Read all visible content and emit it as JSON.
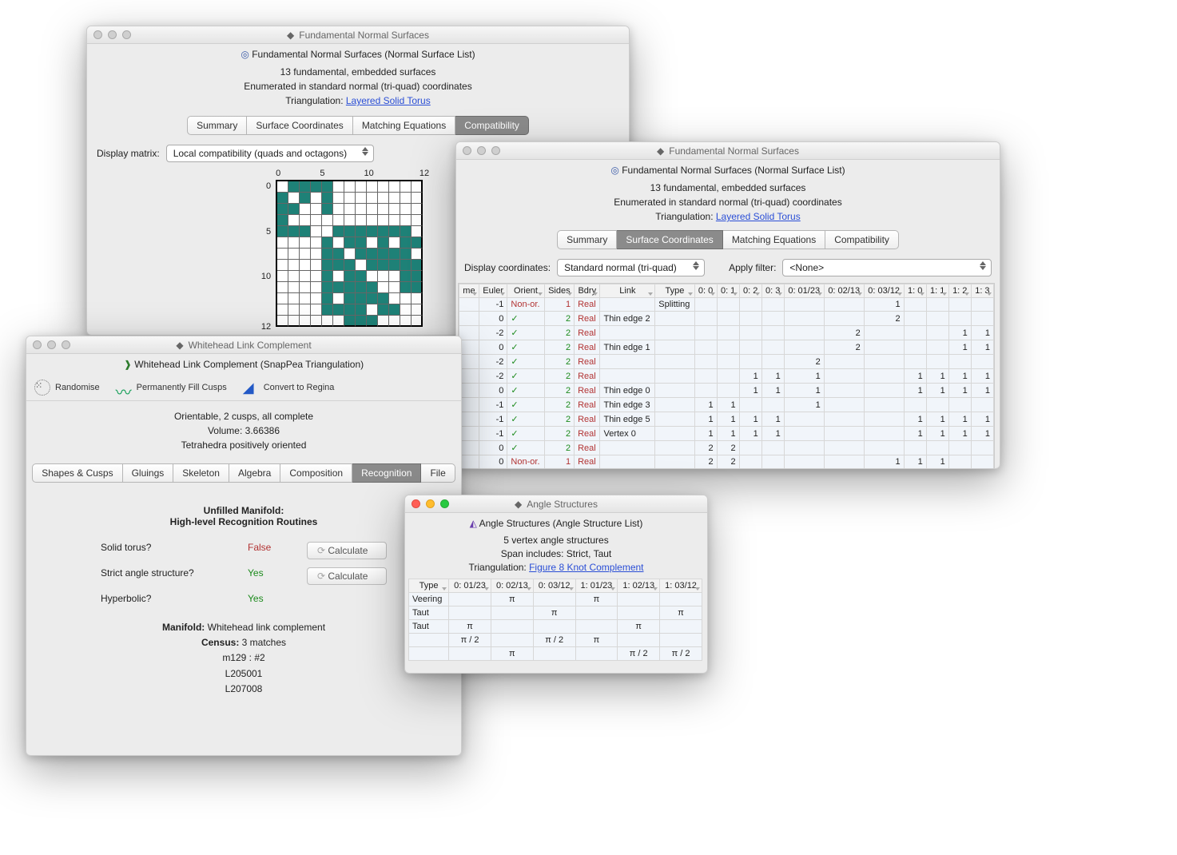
{
  "win1": {
    "title": "Fundamental Normal Surfaces",
    "subtitle": "Fundamental Normal Surfaces (Normal Surface List)",
    "info1": "13 fundamental, embedded surfaces",
    "info2": "Enumerated in standard normal (tri-quad) coordinates",
    "triang_label": "Triangulation: ",
    "triang_link": "Layered Solid Torus",
    "tabs": [
      "Summary",
      "Surface Coordinates",
      "Matching Equations",
      "Compatibility"
    ],
    "select_label": "Display matrix:",
    "select_value": "Local compatibility (quads and octagons)",
    "axis_top": [
      "0",
      "",
      "",
      "",
      "",
      "5",
      "",
      "",
      "",
      "",
      "10",
      "",
      "12"
    ],
    "axis_left": [
      "0",
      "",
      "",
      "",
      "",
      "5",
      "",
      "",
      "",
      "",
      "10",
      "",
      "12"
    ],
    "grid": [
      "0111100000000",
      "1010100000000",
      "1100100000000",
      "1000000000000",
      "1110011111110",
      "0000101101011",
      "0000110111110",
      "0000111011111",
      "0000101100011",
      "0000111110011",
      "0000101111000",
      "0000111101100",
      "0000001110000"
    ]
  },
  "win2": {
    "title": "Fundamental Normal Surfaces",
    "subtitle": "Fundamental Normal Surfaces (Normal Surface List)",
    "info1": "13 fundamental, embedded surfaces",
    "info2": "Enumerated in standard normal (tri-quad) coordinates",
    "triang_label": "Triangulation: ",
    "triang_link": "Layered Solid Torus",
    "tabs": [
      "Summary",
      "Surface Coordinates",
      "Matching Equations",
      "Compatibility"
    ],
    "coord_label": "Display coordinates:",
    "coord_value": "Standard normal (tri-quad)",
    "filter_label": "Apply filter:",
    "filter_value": "<None>",
    "cols": [
      "me",
      "Euler",
      "Orient",
      "Sides",
      "Bdry",
      "Link",
      "Type",
      "0: 0",
      "0: 1",
      "0: 2",
      "0: 3",
      "0: 01/23",
      "0: 02/13",
      "0: 03/12",
      "1: 0",
      "1: 1",
      "1: 2",
      "1: 3"
    ],
    "rows": [
      {
        "euler": "-1",
        "orient": "Non-or.",
        "sides": "1",
        "bdry": "Real",
        "link": "",
        "type": "Splitting",
        "v": [
          "",
          "",
          "",
          "",
          "",
          "",
          "1",
          "",
          "",
          "",
          ""
        ]
      },
      {
        "euler": "0",
        "orient": "✓",
        "sides": "2",
        "bdry": "Real",
        "link": "Thin edge 2",
        "type": "",
        "v": [
          "",
          "",
          "",
          "",
          "",
          "",
          "2",
          "",
          "",
          "",
          ""
        ]
      },
      {
        "euler": "-2",
        "orient": "✓",
        "sides": "2",
        "bdry": "Real",
        "link": "",
        "type": "",
        "v": [
          "",
          "",
          "",
          "",
          "",
          "2",
          "",
          "",
          "",
          "1",
          "1"
        ]
      },
      {
        "euler": "0",
        "orient": "✓",
        "sides": "2",
        "bdry": "Real",
        "link": "Thin edge 1",
        "type": "",
        "v": [
          "",
          "",
          "",
          "",
          "",
          "2",
          "",
          "",
          "",
          "1",
          "1"
        ]
      },
      {
        "euler": "-2",
        "orient": "✓",
        "sides": "2",
        "bdry": "Real",
        "link": "",
        "type": "",
        "v": [
          "",
          "",
          "",
          "",
          "2",
          "",
          "",
          "",
          "",
          "",
          ""
        ]
      },
      {
        "euler": "-2",
        "orient": "✓",
        "sides": "2",
        "bdry": "Real",
        "link": "",
        "type": "",
        "v": [
          "",
          "",
          "1",
          "1",
          "1",
          "",
          "",
          "1",
          "1",
          "1",
          "1"
        ]
      },
      {
        "euler": "0",
        "orient": "✓",
        "sides": "2",
        "bdry": "Real",
        "link": "Thin edge 0",
        "type": "",
        "v": [
          "",
          "",
          "1",
          "1",
          "1",
          "",
          "",
          "1",
          "1",
          "1",
          "1"
        ]
      },
      {
        "euler": "-1",
        "orient": "✓",
        "sides": "2",
        "bdry": "Real",
        "link": "Thin edge 3",
        "type": "",
        "v": [
          "1",
          "1",
          "",
          "",
          "1",
          "",
          "",
          "",
          "",
          "",
          ""
        ]
      },
      {
        "euler": "-1",
        "orient": "✓",
        "sides": "2",
        "bdry": "Real",
        "link": "Thin edge 5",
        "type": "",
        "v": [
          "1",
          "1",
          "1",
          "1",
          "",
          "",
          "",
          "1",
          "1",
          "1",
          "1"
        ]
      },
      {
        "euler": "-1",
        "orient": "✓",
        "sides": "2",
        "bdry": "Real",
        "link": "Vertex 0",
        "type": "",
        "v": [
          "1",
          "1",
          "1",
          "1",
          "",
          "",
          "",
          "1",
          "1",
          "1",
          "1"
        ]
      },
      {
        "euler": "0",
        "orient": "✓",
        "sides": "2",
        "bdry": "Real",
        "link": "",
        "type": "",
        "v": [
          "2",
          "2",
          "",
          "",
          "",
          "",
          "",
          "",
          "",
          "",
          ""
        ]
      },
      {
        "euler": "0",
        "orient": "Non-or.",
        "sides": "1",
        "bdry": "Real",
        "link": "",
        "type": "",
        "v": [
          "2",
          "2",
          "",
          "",
          "",
          "",
          "1",
          "1",
          "1",
          "",
          ""
        ]
      }
    ]
  },
  "win3": {
    "title": "Whitehead Link Complement",
    "subtitle": "Whitehead Link Complement (SnapPea Triangulation)",
    "tools": {
      "rand": "Randomise",
      "fill": "Permanently Fill Cusps",
      "conv": "Convert to Regina"
    },
    "info1": "Orientable, 2 cusps, all complete",
    "info2": "Volume: 3.66386",
    "info3": "Tetrahedra positively oriented",
    "tabs": [
      "Shapes & Cusps",
      "Gluings",
      "Skeleton",
      "Algebra",
      "Composition",
      "Recognition",
      "File"
    ],
    "heading1": "Unfilled Manifold:",
    "heading2": "High-level Recognition Routines",
    "rows": {
      "solid_label": "Solid torus?",
      "solid_val": "False",
      "strict_label": "Strict angle structure?",
      "strict_val": "Yes",
      "hyp_label": "Hyperbolic?",
      "hyp_val": "Yes",
      "calc": "Calculate"
    },
    "manifold_label": "Manifold:",
    "manifold_val": "Whitehead link complement",
    "census_label": "Census:",
    "census_val": "3 matches",
    "matches": [
      "m129 : #2",
      "L205001",
      "L207008"
    ]
  },
  "win4": {
    "title": "Angle Structures",
    "subtitle": "Angle Structures (Angle Structure List)",
    "info1": "5 vertex angle structures",
    "info2": "Span includes: Strict, Taut",
    "triang_label": "Triangulation: ",
    "triang_link": "Figure 8 Knot Complement",
    "cols": [
      "Type",
      "0: 01/23",
      "0: 02/13",
      "0: 03/12",
      "1: 01/23",
      "1: 02/13",
      "1: 03/12"
    ],
    "rows": [
      {
        "t": "Veering",
        "v": [
          "",
          "π",
          "",
          "π",
          "",
          ""
        ]
      },
      {
        "t": "Taut",
        "v": [
          "",
          "",
          "π",
          "",
          "",
          "π"
        ]
      },
      {
        "t": "Taut",
        "v": [
          "π",
          "",
          "",
          "",
          "π",
          ""
        ]
      },
      {
        "t": "",
        "v": [
          "π / 2",
          "",
          "π / 2",
          "π",
          "",
          ""
        ]
      },
      {
        "t": "",
        "v": [
          "",
          "π",
          "",
          "",
          "π / 2",
          "π / 2"
        ]
      }
    ]
  }
}
